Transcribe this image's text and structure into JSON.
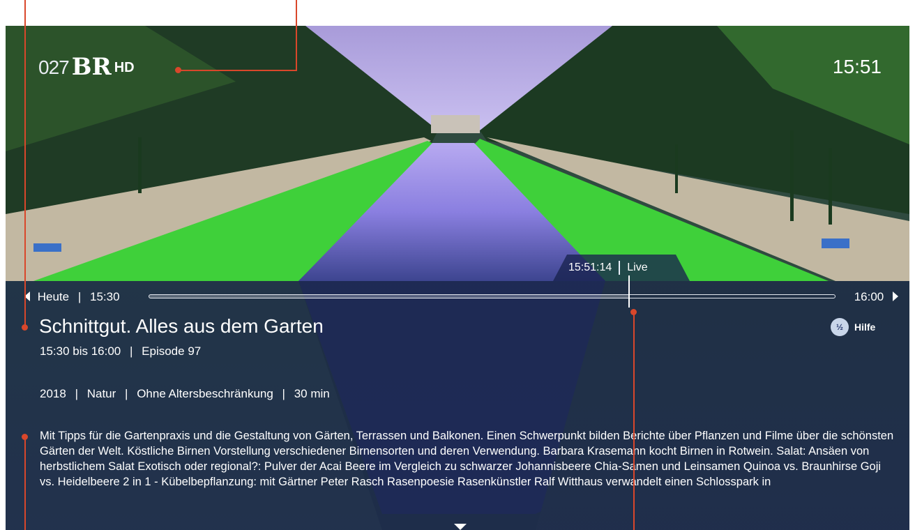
{
  "channel": {
    "number": "027",
    "logo_text": "BR",
    "hd_label": "HD"
  },
  "clock": "15:51",
  "timeline": {
    "day": "Heute",
    "start": "15:30",
    "end": "16:00",
    "current_time": "15:51:14",
    "live_label": "Live",
    "progress": 0.7
  },
  "program": {
    "title": "Schnittgut. Alles aus dem Garten",
    "time_range": "15:30 bis 16:00",
    "episode": "Episode 97",
    "year": "2018",
    "genre": "Natur",
    "age_rating": "Ohne Altersbeschränkung",
    "duration": "30 min",
    "description": "Mit Tipps für die Gartenpraxis und die Gestaltung von Gärten, Terrassen und Balkonen. Einen Schwerpunkt bilden Berichte über Pflanzen und Filme über die schönsten Gärten der Welt. Köstliche Birnen Vorstellung verschiedener Birnensorten und deren Verwendung. Barbara Krasemann kocht Birnen in Rotwein. Salat: Ansäen von herbstlichem Salat Exotisch oder regional?: Pulver der Acai Beere im Vergleich zu schwarzer Johannisbeere Chia-Samen und Leinsamen Quinoa vs. Braunhirse Goji vs. Heidelbeere 2 in 1 - Kübelbepflanzung: mit Gärtner Peter Rasch Rasenpoesie Rasenkünstler Ralf Witthaus verwandelt einen Schlosspark in"
  },
  "help": {
    "label": "Hilfe",
    "icon": "help-icon"
  },
  "separator": "|",
  "colors": {
    "accent": "#d9472b",
    "panel": "#1a2450",
    "lawn": "#3fd03a"
  }
}
